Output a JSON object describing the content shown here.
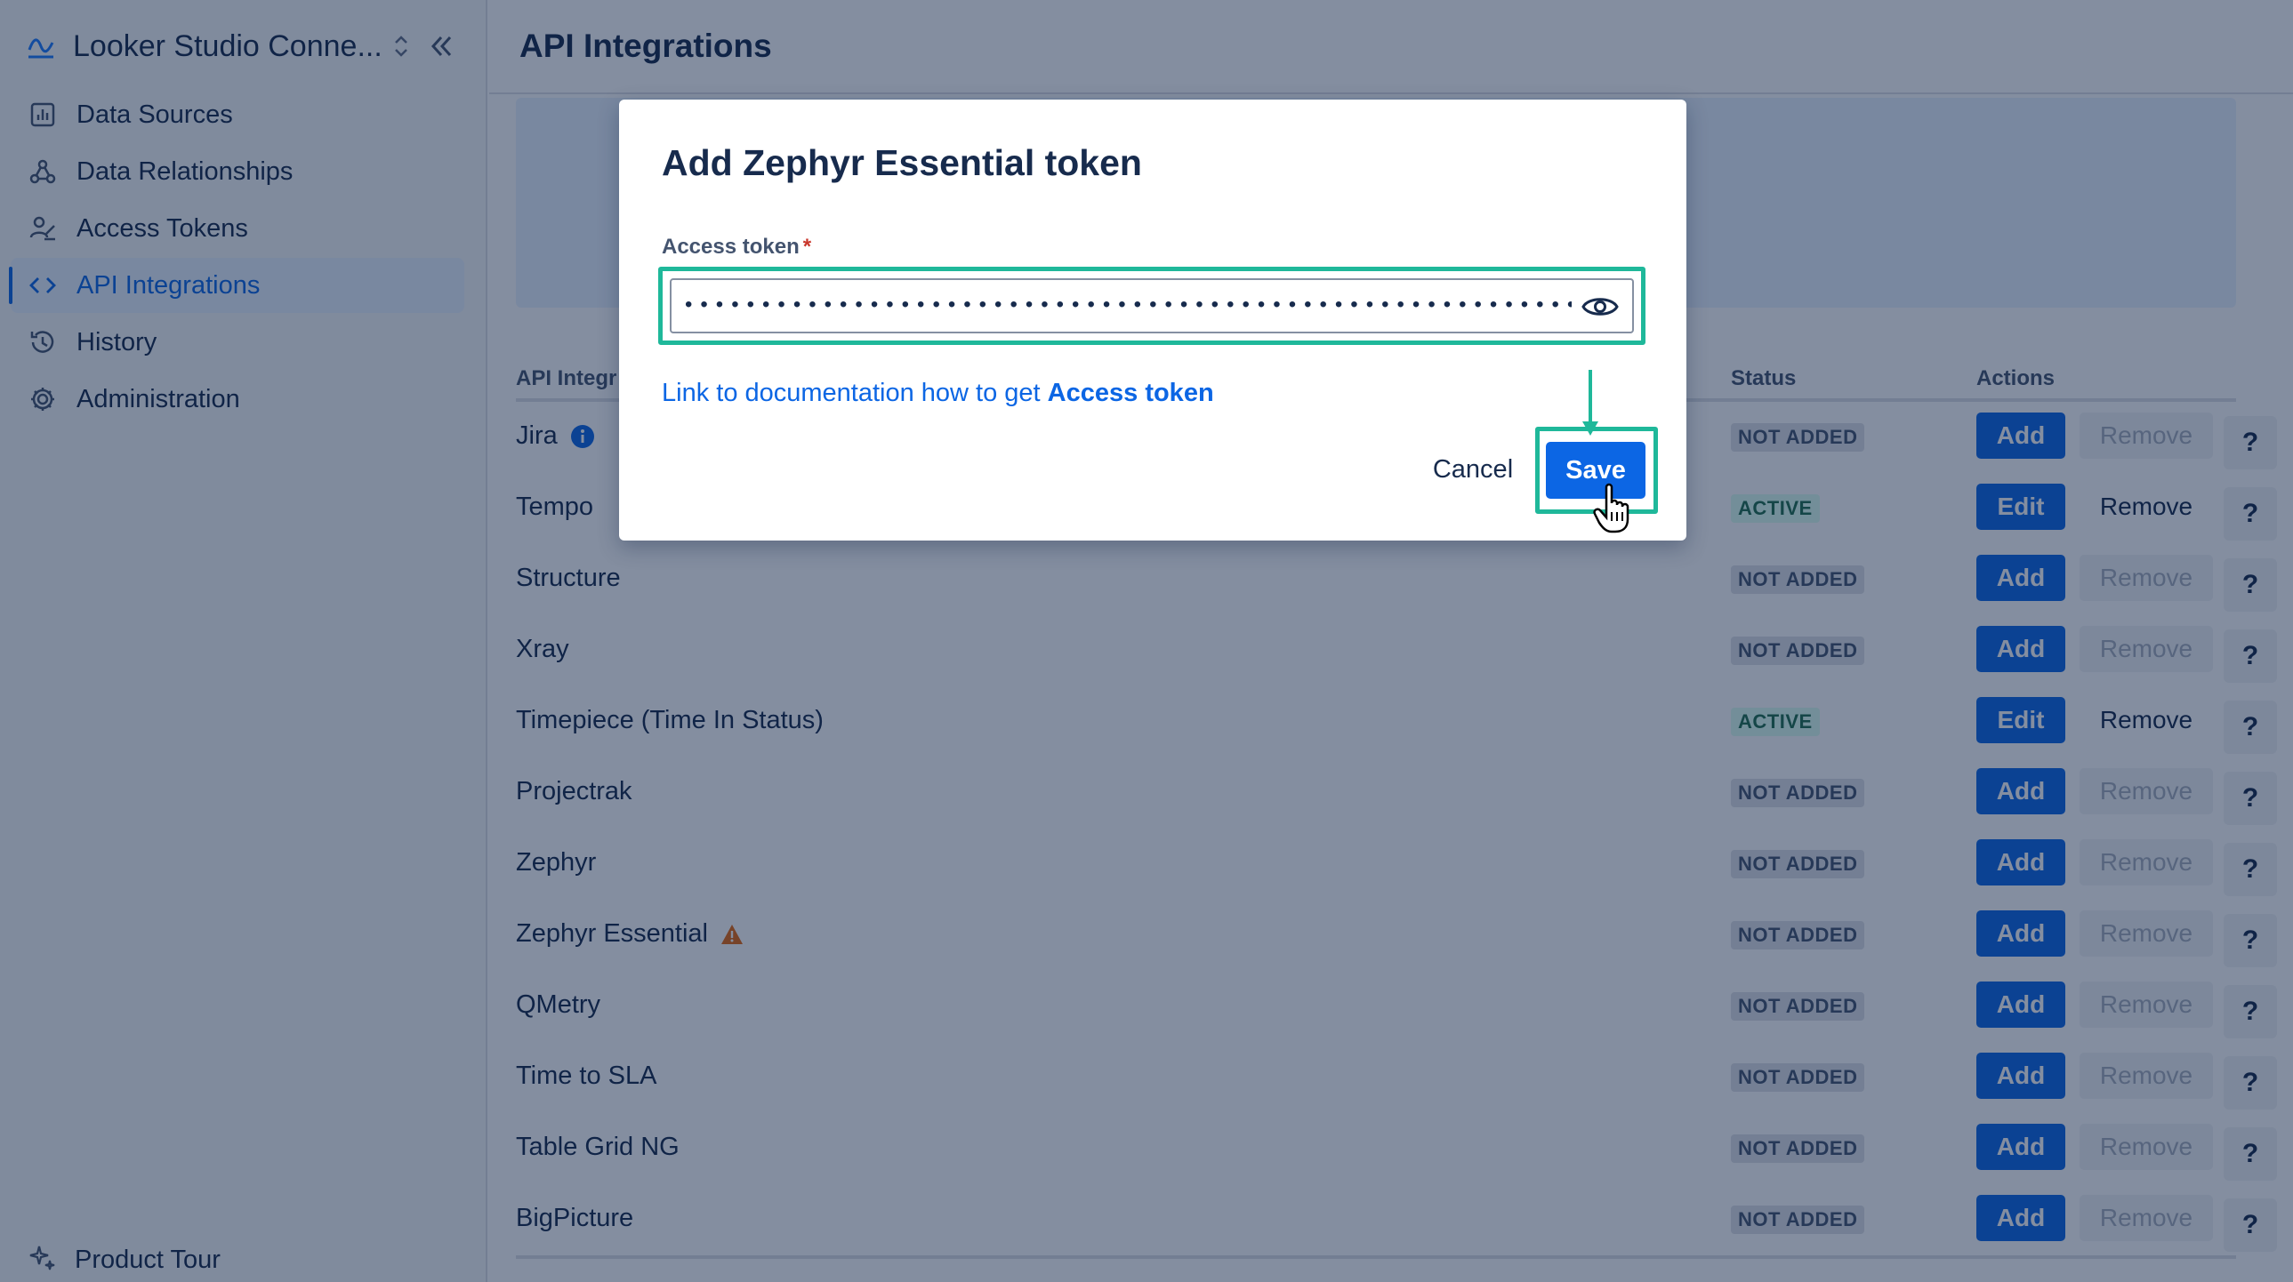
{
  "sidebar": {
    "app_title": "Looker Studio Conne...",
    "items": [
      {
        "label": "Data Sources",
        "icon": "chart-icon"
      },
      {
        "label": "Data Relationships",
        "icon": "webhook-icon"
      },
      {
        "label": "Access Tokens",
        "icon": "person-sign-icon"
      },
      {
        "label": "API Integrations",
        "icon": "code-icon",
        "active": true
      },
      {
        "label": "History",
        "icon": "history-icon"
      },
      {
        "label": "Administration",
        "icon": "gear-icon"
      }
    ],
    "product_tour": "Product Tour"
  },
  "main": {
    "title": "API Integrations",
    "table": {
      "headers": {
        "name": "API Integr",
        "status": "Status",
        "actions": "Actions"
      },
      "rows": [
        {
          "name": "Jira",
          "status": "NOT ADDED",
          "primary": "Add",
          "remove": "Remove",
          "help": "?"
        },
        {
          "name": "Tempo",
          "status": "ACTIVE",
          "primary": "Edit",
          "remove": "Remove",
          "help": "?"
        },
        {
          "name": "Structure",
          "status": "NOT ADDED",
          "primary": "Add",
          "remove": "Remove",
          "help": "?"
        },
        {
          "name": "Xray",
          "status": "NOT ADDED",
          "primary": "Add",
          "remove": "Remove",
          "help": "?"
        },
        {
          "name": "Timepiece (Time In Status)",
          "status": "ACTIVE",
          "primary": "Edit",
          "remove": "Remove",
          "help": "?"
        },
        {
          "name": "Projectrak",
          "status": "NOT ADDED",
          "primary": "Add",
          "remove": "Remove",
          "help": "?"
        },
        {
          "name": "Zephyr",
          "status": "NOT ADDED",
          "primary": "Add",
          "remove": "Remove",
          "help": "?"
        },
        {
          "name": "Zephyr Essential",
          "status": "NOT ADDED",
          "primary": "Add",
          "remove": "Remove",
          "help": "?"
        },
        {
          "name": "QMetry",
          "status": "NOT ADDED",
          "primary": "Add",
          "remove": "Remove",
          "help": "?"
        },
        {
          "name": "Time to SLA",
          "status": "NOT ADDED",
          "primary": "Add",
          "remove": "Remove",
          "help": "?"
        },
        {
          "name": "Table Grid NG",
          "status": "NOT ADDED",
          "primary": "Add",
          "remove": "Remove",
          "help": "?"
        },
        {
          "name": "BigPicture",
          "status": "NOT ADDED",
          "primary": "Add",
          "remove": "Remove",
          "help": "?"
        }
      ]
    }
  },
  "modal": {
    "title": "Add Zephyr Essential token",
    "field_label": "Access token",
    "required_mark": "*",
    "token_value": "••••••••••••••••••••••••••••••••••••••••••••••••••••••••••••••••",
    "link_prefix": "Link to documentation how to get ",
    "link_bold": "Access token",
    "cancel": "Cancel",
    "save": "Save"
  },
  "colors": {
    "accent": "#0c66e4",
    "highlight": "#1fb89a",
    "active_status": "#216e4e",
    "warning": "#e56910"
  }
}
